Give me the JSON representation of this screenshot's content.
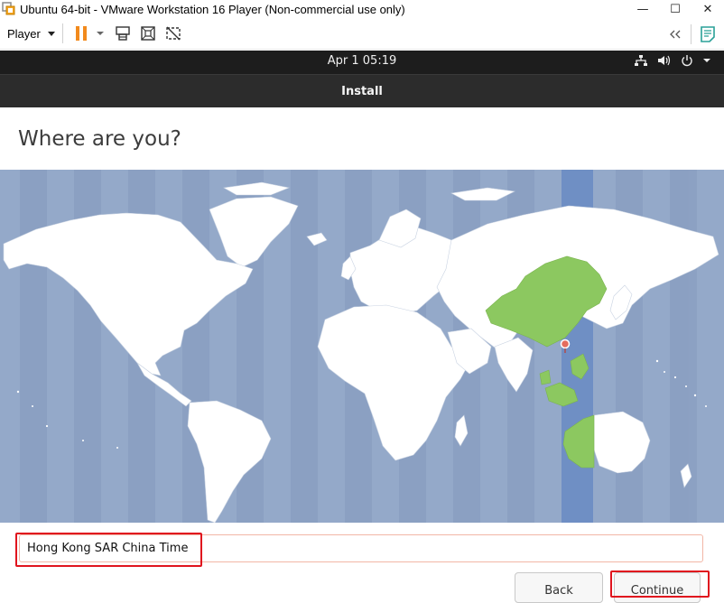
{
  "window": {
    "title": "Ubuntu 64-bit - VMware Workstation 16 Player (Non-commercial use only)",
    "minimize": "—",
    "maximize": "☐",
    "close": "✕"
  },
  "toolbar": {
    "player_label": "Player",
    "icons": [
      "pause-icon",
      "send-ctrl-alt-del-icon",
      "fit-guest-icon",
      "unity-icon",
      "back-icon",
      "notes-icon"
    ]
  },
  "topbar": {
    "clock": "Apr 1  05:19"
  },
  "installer": {
    "header": "Install",
    "heading": "Where are you?",
    "timezone_value": "Hong Kong SAR China Time",
    "back_label": "Back",
    "continue_label": "Continue"
  },
  "colors": {
    "ocean": "#94a9c9",
    "land": "#ffffff",
    "selected_region": "#8cc860",
    "selected_band": "#6f8fc4",
    "input_border": "#f2b6a6",
    "highlight": "#e0141e"
  }
}
